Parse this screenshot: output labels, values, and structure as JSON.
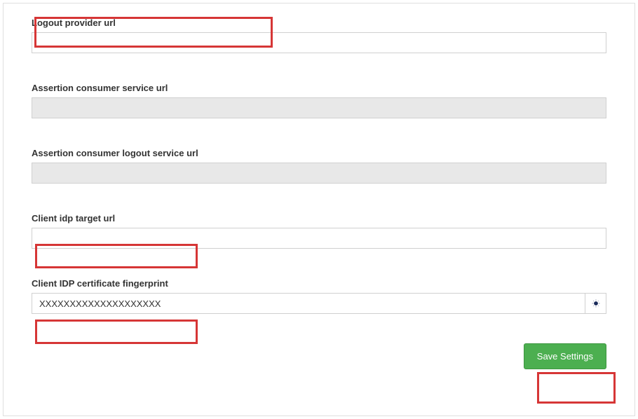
{
  "form": {
    "logout_provider_url": {
      "label": "Logout provider url",
      "value": "",
      "placeholder": ""
    },
    "assertion_consumer_service_url": {
      "label": "Assertion consumer service url",
      "value": "",
      "placeholder": ""
    },
    "assertion_consumer_logout_service_url": {
      "label": "Assertion consumer logout service url",
      "value": "",
      "placeholder": ""
    },
    "client_idp_target_url": {
      "label": "Client idp target url",
      "value": "",
      "placeholder": ""
    },
    "client_idp_certificate_fingerprint": {
      "label": "Client IDP certificate fingerprint",
      "value": "XXXXXXXXXXXXXXXXXXXX",
      "placeholder": ""
    }
  },
  "buttons": {
    "save_settings": "Save Settings"
  }
}
